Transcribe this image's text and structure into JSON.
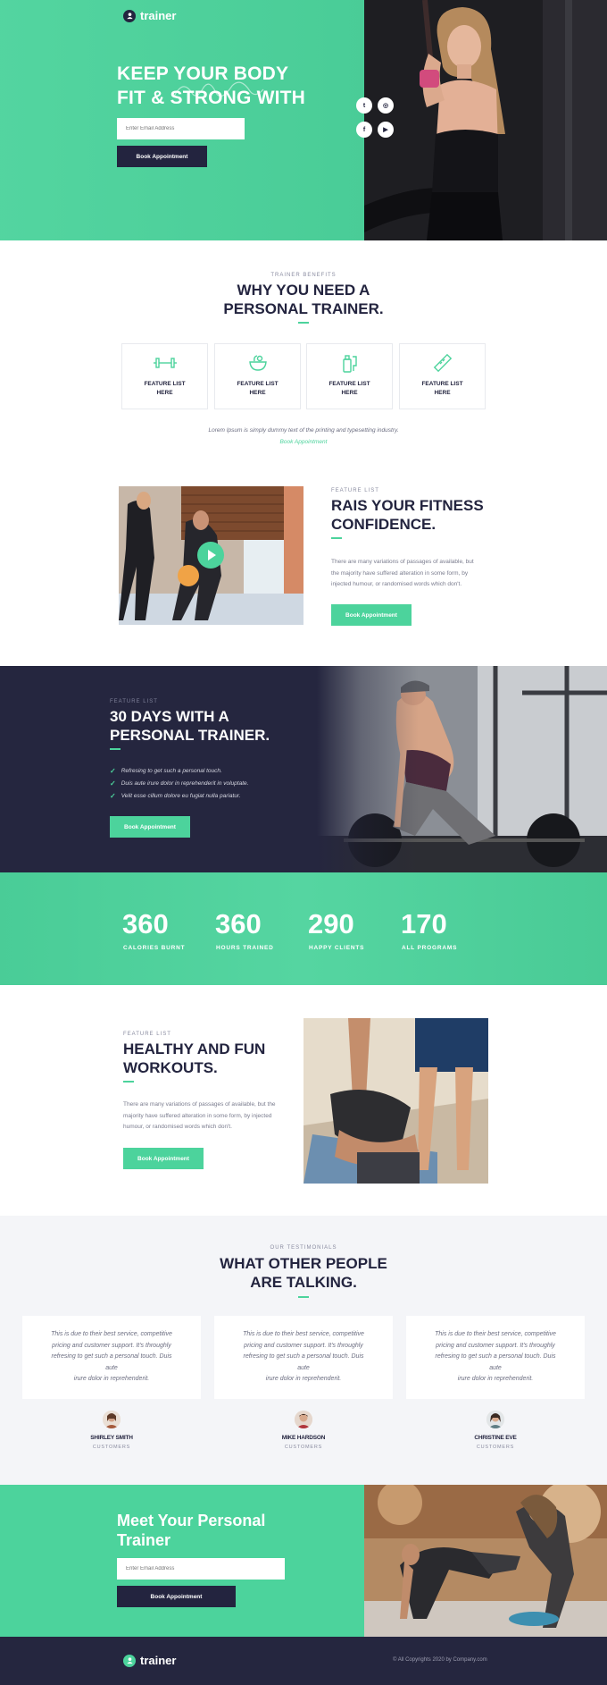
{
  "brand": {
    "name": "trainer",
    "accent": "#4cd39c",
    "navy": "#25263f"
  },
  "hero": {
    "title_line1": "KEEP YOUR BODY",
    "title_line2": "FIT & STRONG WITH",
    "email_placeholder": "Enter Email Address",
    "button": "Book Appointment",
    "social": [
      "twitter-icon",
      "instagram-icon",
      "facebook-icon",
      "youtube-icon"
    ]
  },
  "benefits": {
    "kicker": "TRAINER BENEFITS",
    "title_line1": "WHY YOU NEED A",
    "title_line2": "PERSONAL TRAINER.",
    "features": [
      {
        "icon": "dumbbell-icon",
        "line1": "FEATURE LIST",
        "line2": "HERE"
      },
      {
        "icon": "bowl-icon",
        "line1": "FEATURE LIST",
        "line2": "HERE"
      },
      {
        "icon": "bottle-icon",
        "line1": "FEATURE LIST",
        "line2": "HERE"
      },
      {
        "icon": "ruler-icon",
        "line1": "FEATURE LIST",
        "line2": "HERE"
      }
    ],
    "note": "Lorem Ipsum is simply dummy text of the printing and typesetting industry.",
    "link": "Book Appointment"
  },
  "confidence": {
    "kicker": "FEATURE LIST",
    "title_line1": "RAIS YOUR FITNESS",
    "title_line2": "CONFIDENCE.",
    "para_line1": "There are many variations of passages of available, but",
    "para_line2": "the majority have suffered alteration in some form, by",
    "para_line3": "injected humour, or randomised words which don't.",
    "button": "Book Appointment"
  },
  "thirty_days": {
    "kicker": "FEATURE LIST",
    "title_line1": "30 DAYS WITH A",
    "title_line2": "PERSONAL TRAINER.",
    "checks": [
      "Refresing to get such a personal touch.",
      "Duis aute irure dolor in reprehenderit in voluptate.",
      "Velit esse cillum dolore eu fugiat nulla pariatur."
    ],
    "button": "Book Appointment"
  },
  "stats": [
    {
      "value": "360",
      "label": "CALORIES BURNT"
    },
    {
      "value": "360",
      "label": "HOURS TRAINED"
    },
    {
      "value": "290",
      "label": "HAPPY CLIENTS"
    },
    {
      "value": "170",
      "label": "ALL PROGRAMS"
    }
  ],
  "healthy": {
    "kicker": "FEATURE LIST",
    "title_line1": "HEALTHY AND FUN",
    "title_line2": "WORKOUTS.",
    "para_line1": "There are many variations of passages of available, but the",
    "para_line2": "majority have suffered alteration in some form, by injected",
    "para_line3": "humour, or randomised words which don't.",
    "button": "Book Appointment"
  },
  "testimonials": {
    "kicker": "OUR TESTIMONIALS",
    "title_line1": "WHAT OTHER PEOPLE",
    "title_line2": "ARE TALKING.",
    "items": [
      {
        "l1": "This is due to their best service, competitive",
        "l2": "pricing and customer support. It's throughly",
        "l3": "refresing to get such a personal touch. Duis aute",
        "l4": "irure dolor in reprehenderit.",
        "name": "SHIRLEY SMITH",
        "role": "CUSTOMERS"
      },
      {
        "l1": "This is due to their best service, competitive",
        "l2": "pricing and customer support. It's throughly",
        "l3": "refresing to get such a personal touch. Duis aute",
        "l4": "irure dolor in reprehenderit.",
        "name": "MIKE HARDSON",
        "role": "CUSTOMERS"
      },
      {
        "l1": "This is due to their best service, competitive",
        "l2": "pricing and customer support. It's throughly",
        "l3": "refresing to get such a personal touch. Duis aute",
        "l4": "irure dolor in reprehenderit.",
        "name": "CHRISTINE EVE",
        "role": "CUSTOMERS"
      }
    ]
  },
  "meet": {
    "title_line1": "Meet Your Personal",
    "title_line2": "Trainer",
    "email_placeholder": "Enter Email Address",
    "button": "Book Appointment"
  },
  "footer": {
    "copyright": "© All Copyrights 2020 by Company.com"
  }
}
